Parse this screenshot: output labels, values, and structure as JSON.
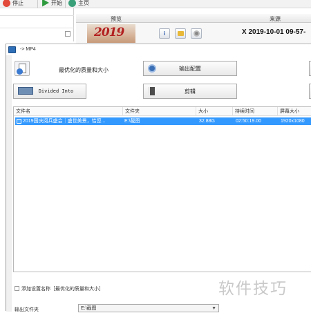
{
  "toolbar": {
    "stop_label": "停止",
    "start_label": "开始",
    "home_label": "主页"
  },
  "background_list": {
    "col_preview": "预览",
    "col_source": "来源",
    "thumbnail_text": "2019",
    "source_value": "X 2019-10-01 09-57-"
  },
  "dialog": {
    "title": "-> MP4",
    "profile_label": "最优化的质量和大小",
    "output_settings_label": "输出配置",
    "divided_into_label": "Divided Into",
    "cut_label": "剪辑",
    "table": {
      "columns": [
        "文件名",
        "文件夹",
        "大小",
        "持续时间",
        "屏幕大小"
      ],
      "rows": [
        {
          "filename": "2019国庆阅兵盛会｜盛世美景，恰您...",
          "folder": "E:\\截图",
          "size": "32.88G",
          "duration": "02:50:19.00",
          "screen_size": "1920x1080"
        }
      ]
    },
    "add_setting_name_label": "添加设置名称［最优化的质量和大小］",
    "output_folder_label": "输出文件夹",
    "output_folder_value": "E:\\截图"
  },
  "watermark": "软件技巧",
  "colors": {
    "selection": "#3399ff",
    "stop": "#e24a3b",
    "start": "#2e9b3e"
  }
}
